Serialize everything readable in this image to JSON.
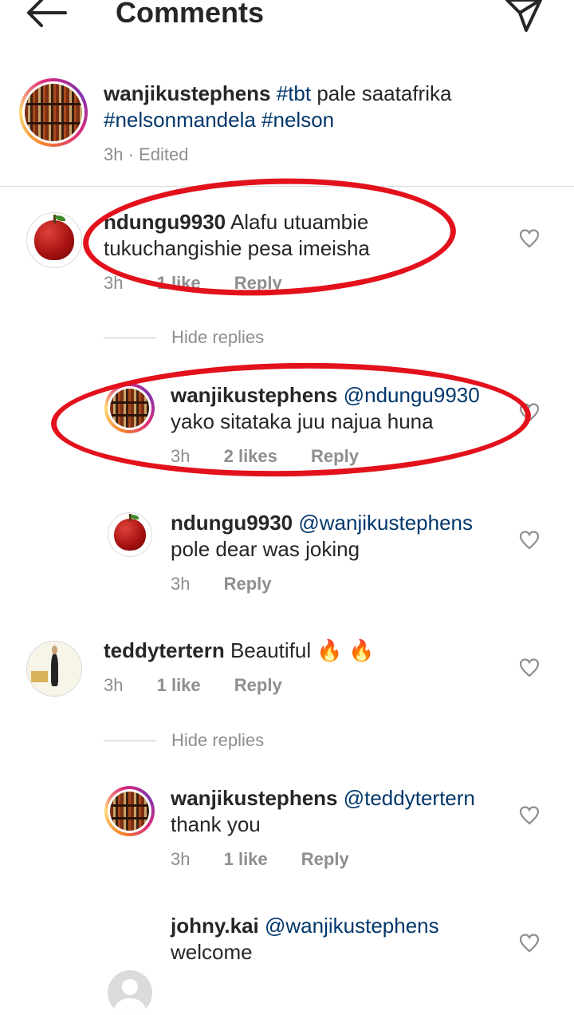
{
  "header": {
    "title": "Comments",
    "back_icon": "arrow-left-icon",
    "send_icon": "paper-plane-icon"
  },
  "caption": {
    "username": "wanjikustephens",
    "tag1": "#tbt",
    "text": "pale saatafrika",
    "tag2": "#nelsonmandela",
    "tag3": "#nelson",
    "time": "3h",
    "edited": "· Edited"
  },
  "comments": [
    {
      "username": "ndungu9930",
      "text1": "Alafu utuambie",
      "text2": "tukuchangishie pesa imeisha",
      "time": "3h",
      "likes": "1 like",
      "reply": "Reply"
    },
    {
      "username": "teddytertern",
      "text": "Beautiful",
      "emoji": "🔥 🔥",
      "time": "3h",
      "likes": "1 like",
      "reply": "Reply"
    }
  ],
  "replies": [
    {
      "username": "wanjikustephens",
      "mention": "@ndungu9930",
      "text": "yako sitataka juu najua huna",
      "time": "3h",
      "likes": "2 likes",
      "reply": "Reply"
    },
    {
      "username": "ndungu9930",
      "mention": "@wanjikustephens",
      "text": "pole dear was joking",
      "time": "3h",
      "reply": "Reply"
    },
    {
      "username": "wanjikustephens",
      "mention": "@teddytertern",
      "text": "thank you",
      "time": "3h",
      "likes": "1 like",
      "reply": "Reply"
    },
    {
      "username": "johny.kai",
      "mention": "@wanjikustephens",
      "text": "welcome"
    }
  ],
  "hide_replies": "Hide replies",
  "colors": {
    "link": "#00376b",
    "annotation": "#e3111b",
    "muted": "#8e8e8e"
  }
}
